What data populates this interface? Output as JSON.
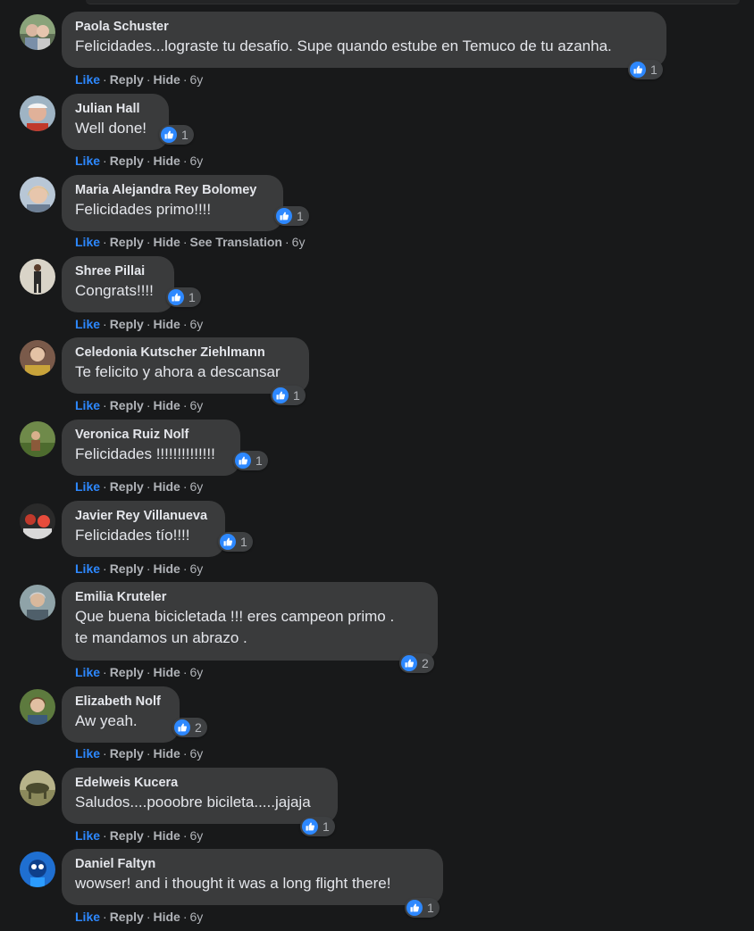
{
  "actions": {
    "like": "Like",
    "reply": "Reply",
    "hide": "Hide",
    "see_translation": "See Translation",
    "separator": "·"
  },
  "colors": {
    "background": "#18191a",
    "bubble": "#3a3b3c",
    "like_blue": "#2d88ff",
    "meta": "#b0b3b8"
  },
  "comments": [
    {
      "author": "Paola Schuster",
      "text": "Felicidades...lograste tu desafio. Supe quando estube en Temuco de tu azanha.",
      "reactions": "1",
      "age": "6y"
    },
    {
      "author": "Julian Hall",
      "text": "Well done!",
      "reactions": "1",
      "age": "6y"
    },
    {
      "author": "Maria Alejandra Rey Bolomey",
      "text": "Felicidades primo!!!!",
      "reactions": "1",
      "age": "6y"
    },
    {
      "author": "Shree Pillai",
      "text": "Congrats!!!!",
      "reactions": "1",
      "age": "6y"
    },
    {
      "author": "Celedonia Kutscher Ziehlmann",
      "text": "Te felicito y ahora a descansar",
      "reactions": "1",
      "age": "6y"
    },
    {
      "author": "Veronica Ruiz Nolf",
      "text": "Felicidades !!!!!!!!!!!!!!",
      "reactions": "1",
      "age": "6y"
    },
    {
      "author": "Javier Rey Villanueva",
      "text": "Felicidades tío!!!!",
      "reactions": "1",
      "age": "6y"
    },
    {
      "author": "Emilia Kruteler",
      "text": "Que buena bicicletada !!! eres campeon primo .\nte mandamos un abrazo .",
      "reactions": "2",
      "age": "6y"
    },
    {
      "author": "Elizabeth Nolf",
      "text": "Aw yeah.",
      "reactions": "2",
      "age": "6y"
    },
    {
      "author": "Edelweis Kucera",
      "text": "Saludos....pooobre bicileta.....jajaja",
      "reactions": "1",
      "age": "6y"
    },
    {
      "author": "Daniel Faltyn",
      "text": "wowser! and i thought it was a long flight there!",
      "reactions": "1",
      "age": "6y"
    }
  ]
}
